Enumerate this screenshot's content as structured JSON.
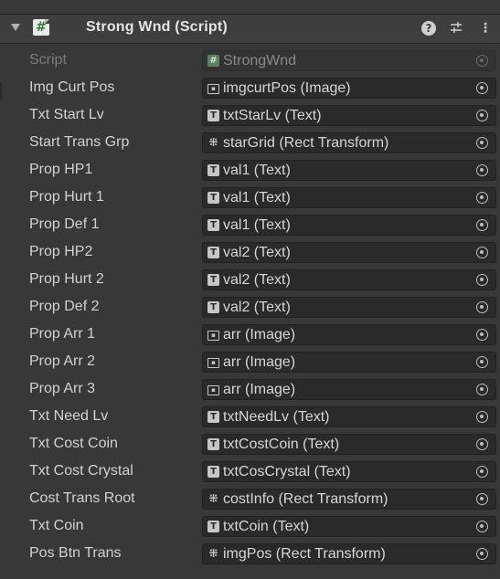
{
  "component": {
    "title": "Strong Wnd (Script)",
    "icon": "csharp-script-icon"
  },
  "header_buttons": [
    "help-icon",
    "presets-icon",
    "context-menu-icon"
  ],
  "fields": [
    {
      "label": "Script",
      "value": "StrongWnd",
      "type": "script",
      "disabled": true
    },
    {
      "label": "Img Curt Pos",
      "value": "imgcurtPos (Image)",
      "type": "image"
    },
    {
      "label": "Txt Start Lv",
      "value": "txtStarLv (Text)",
      "type": "text"
    },
    {
      "label": "Start Trans Grp",
      "value": "starGrid (Rect Transform)",
      "type": "rect"
    },
    {
      "label": "Prop HP1",
      "value": "val1 (Text)",
      "type": "text"
    },
    {
      "label": "Prop Hurt 1",
      "value": "val1 (Text)",
      "type": "text"
    },
    {
      "label": "Prop Def 1",
      "value": "val1 (Text)",
      "type": "text"
    },
    {
      "label": "Prop HP2",
      "value": "val2 (Text)",
      "type": "text"
    },
    {
      "label": "Prop Hurt 2",
      "value": "val2 (Text)",
      "type": "text"
    },
    {
      "label": "Prop Def 2",
      "value": "val2 (Text)",
      "type": "text"
    },
    {
      "label": "Prop Arr 1",
      "value": "arr (Image)",
      "type": "image"
    },
    {
      "label": "Prop Arr 2",
      "value": "arr (Image)",
      "type": "image"
    },
    {
      "label": "Prop Arr 3",
      "value": "arr (Image)",
      "type": "image"
    },
    {
      "label": "Txt Need Lv",
      "value": "txtNeedLv (Text)",
      "type": "text"
    },
    {
      "label": "Txt Cost Coin",
      "value": "txtCostCoin (Text)",
      "type": "text"
    },
    {
      "label": "Txt Cost Crystal",
      "value": "txtCosCrystal (Text)",
      "type": "text"
    },
    {
      "label": "Cost Trans Root",
      "value": "costInfo (Rect Transform)",
      "type": "rect"
    },
    {
      "label": "Txt Coin",
      "value": "txtCoin (Text)",
      "type": "text"
    },
    {
      "label": "Pos Btn Trans",
      "value": "imgPos (Rect Transform)",
      "type": "rect"
    }
  ]
}
